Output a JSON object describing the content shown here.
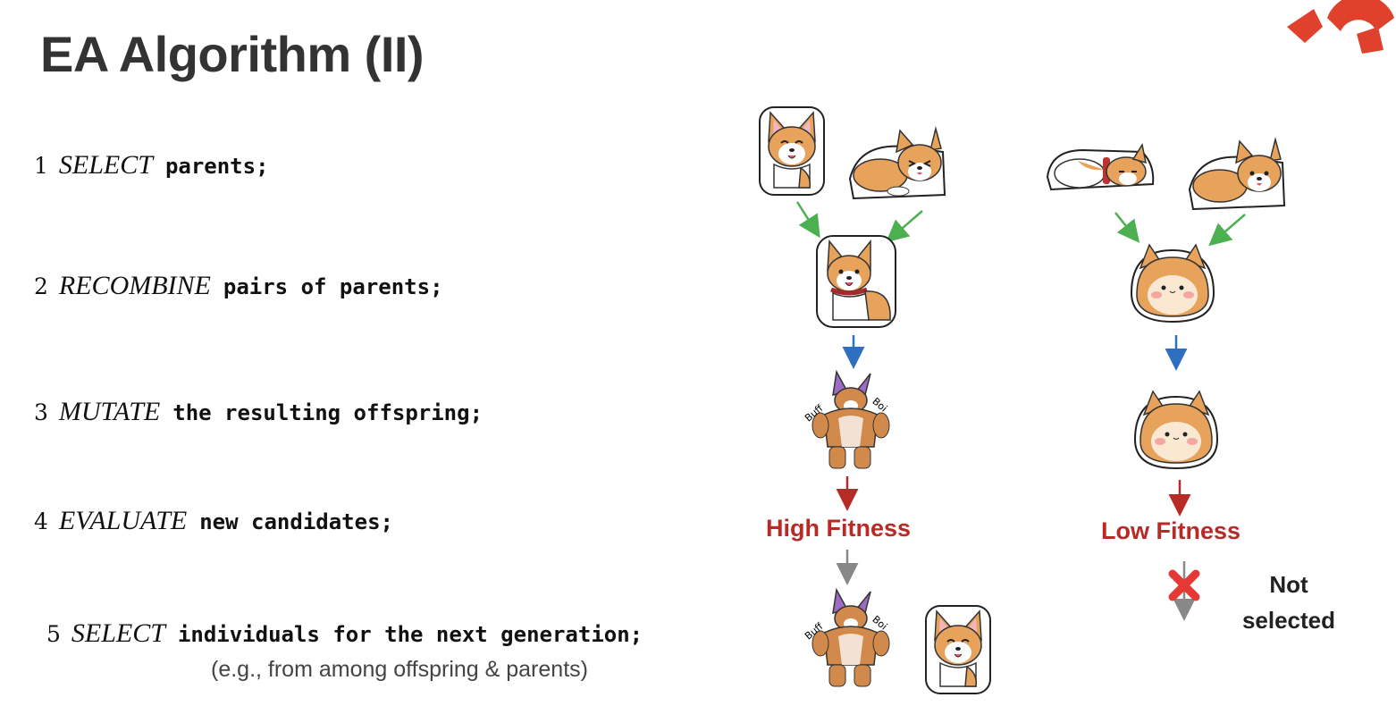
{
  "slide": {
    "title": "EA Algorithm (II)"
  },
  "steps": [
    {
      "num": "1",
      "keyword": "SELECT",
      "text": "parents;"
    },
    {
      "num": "2",
      "keyword": "RECOMBINE",
      "text": "pairs of parents;"
    },
    {
      "num": "3",
      "keyword": "MUTATE",
      "text": "the resulting offspring;"
    },
    {
      "num": "4",
      "keyword": "EVALUATE",
      "text": "new candidates;"
    },
    {
      "num": "5",
      "keyword": "SELECT",
      "text": "individuals for the next generation;"
    }
  ],
  "note": "(e.g., from among offspring & parents)",
  "labels": {
    "high_fitness": "High Fitness",
    "low_fitness": "Low Fitness",
    "not_selected_line1": "Not",
    "not_selected_line2": "selected",
    "buff_word1": "Buff",
    "buff_word2": "Boi"
  },
  "colors": {
    "green_arrow": "#4caf50",
    "blue_arrow": "#2f6fc0",
    "red_arrow": "#b72a26",
    "gray_arrow": "#888888",
    "fitness_text": "#b72a26",
    "logo": "#e0412c"
  },
  "icons": [
    "corgi-sitting-icon",
    "corgi-lying-icon",
    "corgi-collar-icon",
    "buff-corgi-icon",
    "round-corgi-icon",
    "red-x-icon",
    "logo-icon"
  ]
}
